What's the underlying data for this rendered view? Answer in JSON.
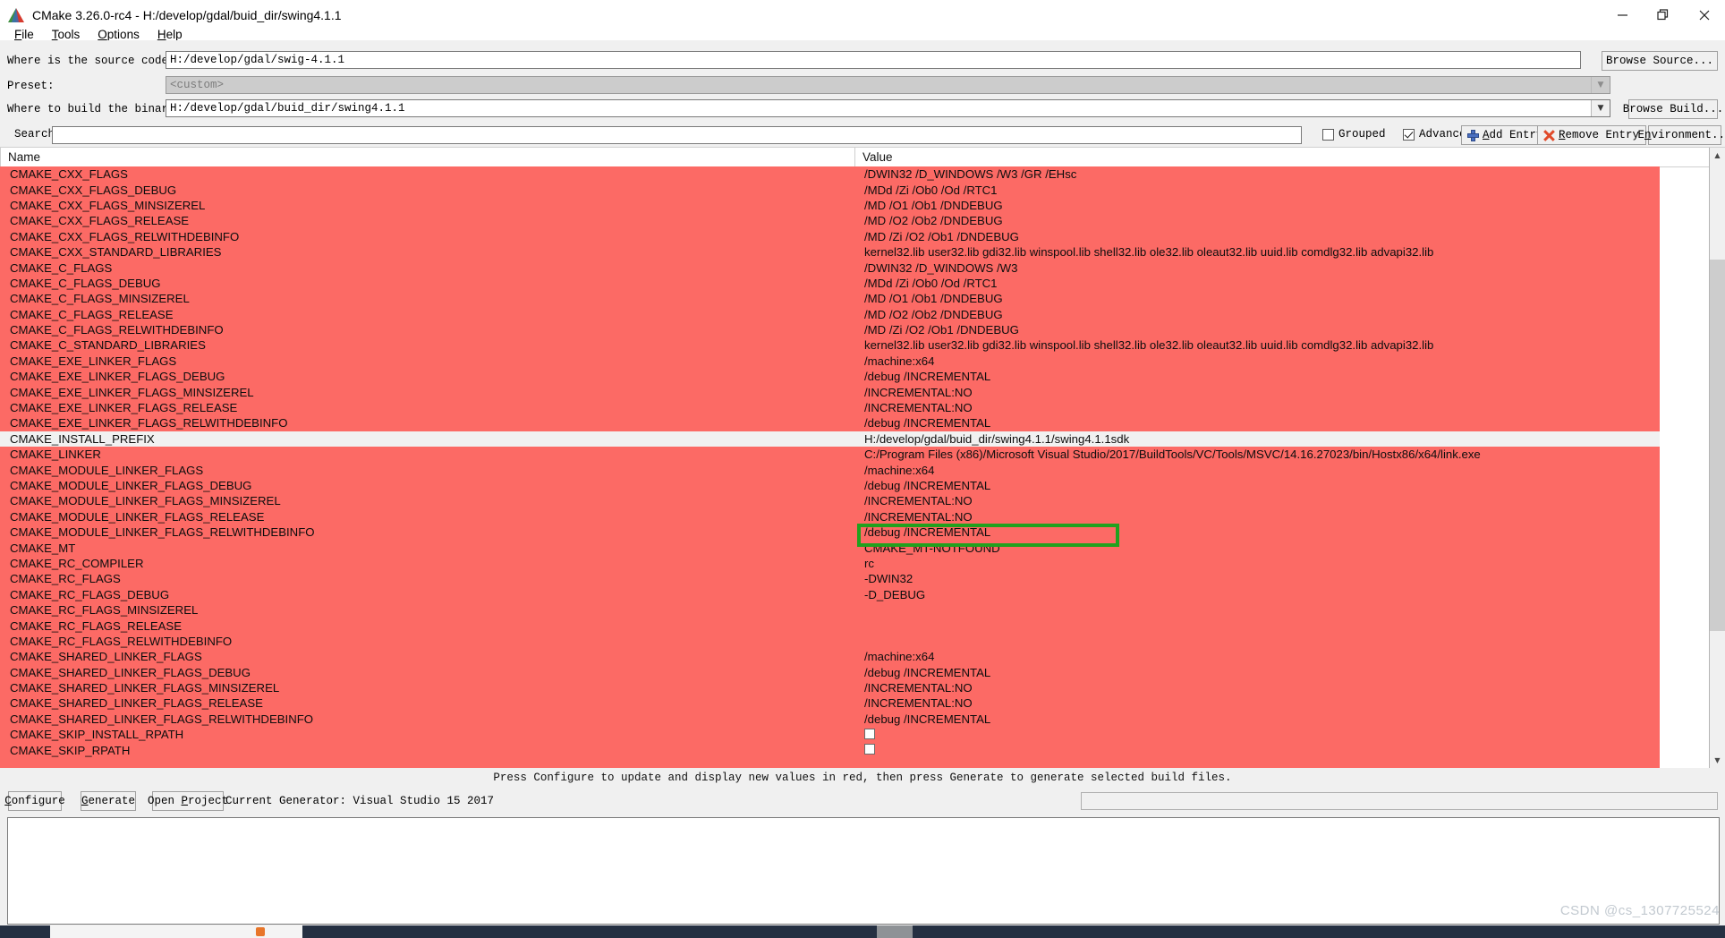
{
  "window": {
    "title": "CMake 3.26.0-rc4 - H:/develop/gdal/buid_dir/swing4.1.1",
    "app_icon": "cmake-triangle-icon",
    "controls": {
      "minimize": "—",
      "maximize": "❐",
      "close": "✕"
    }
  },
  "menubar": {
    "items": [
      {
        "label": "File",
        "mnemonic": "F"
      },
      {
        "label": "Tools",
        "mnemonic": "T"
      },
      {
        "label": "Options",
        "mnemonic": "O"
      },
      {
        "label": "Help",
        "mnemonic": "H"
      }
    ]
  },
  "form": {
    "source_label": "Where is the source code:",
    "source_value": "H:/develop/gdal/swig-4.1.1",
    "browse_source_label": "Browse Source...",
    "preset_label": "Preset:",
    "preset_value": "<custom>",
    "build_label": "Where to build the binaries:",
    "build_value": "H:/develop/gdal/buid_dir/swing4.1.1",
    "browse_build_label": "Browse Build..."
  },
  "search": {
    "label": "Search:",
    "value": "",
    "grouped_label": "Grouped",
    "grouped_checked": false,
    "advanced_label": "Advanced",
    "advanced_checked": true,
    "add_entry_label": "Add Entry",
    "remove_entry_label": "Remove Entry",
    "environment_label": "Environment..."
  },
  "table": {
    "columns": [
      "Name",
      "Value"
    ],
    "selected_index": 16,
    "rows": [
      {
        "name": "CMAKE_CXX_FLAGS",
        "value": "/DWIN32 /D_WINDOWS /W3 /GR /EHsc"
      },
      {
        "name": "CMAKE_CXX_FLAGS_DEBUG",
        "value": "/MDd /Zi /Ob0 /Od /RTC1"
      },
      {
        "name": "CMAKE_CXX_FLAGS_MINSIZEREL",
        "value": "/MD /O1 /Ob1 /DNDEBUG"
      },
      {
        "name": "CMAKE_CXX_FLAGS_RELEASE",
        "value": "/MD /O2 /Ob2 /DNDEBUG"
      },
      {
        "name": "CMAKE_CXX_FLAGS_RELWITHDEBINFO",
        "value": "/MD /Zi /O2 /Ob1 /DNDEBUG"
      },
      {
        "name": "CMAKE_CXX_STANDARD_LIBRARIES",
        "value": "kernel32.lib user32.lib gdi32.lib winspool.lib shell32.lib ole32.lib oleaut32.lib uuid.lib comdlg32.lib advapi32.lib"
      },
      {
        "name": "CMAKE_C_FLAGS",
        "value": "/DWIN32 /D_WINDOWS /W3"
      },
      {
        "name": "CMAKE_C_FLAGS_DEBUG",
        "value": "/MDd /Zi /Ob0 /Od /RTC1"
      },
      {
        "name": "CMAKE_C_FLAGS_MINSIZEREL",
        "value": "/MD /O1 /Ob1 /DNDEBUG"
      },
      {
        "name": "CMAKE_C_FLAGS_RELEASE",
        "value": "/MD /O2 /Ob2 /DNDEBUG"
      },
      {
        "name": "CMAKE_C_FLAGS_RELWITHDEBINFO",
        "value": "/MD /Zi /O2 /Ob1 /DNDEBUG"
      },
      {
        "name": "CMAKE_C_STANDARD_LIBRARIES",
        "value": "kernel32.lib user32.lib gdi32.lib winspool.lib shell32.lib ole32.lib oleaut32.lib uuid.lib comdlg32.lib advapi32.lib"
      },
      {
        "name": "CMAKE_EXE_LINKER_FLAGS",
        "value": "/machine:x64"
      },
      {
        "name": "CMAKE_EXE_LINKER_FLAGS_DEBUG",
        "value": "/debug /INCREMENTAL"
      },
      {
        "name": "CMAKE_EXE_LINKER_FLAGS_MINSIZEREL",
        "value": "/INCREMENTAL:NO"
      },
      {
        "name": "CMAKE_EXE_LINKER_FLAGS_RELEASE",
        "value": "/INCREMENTAL:NO"
      },
      {
        "name": "CMAKE_EXE_LINKER_FLAGS_RELWITHDEBINFO",
        "value": "/debug /INCREMENTAL"
      },
      {
        "name": "CMAKE_INSTALL_PREFIX",
        "value": "H:/develop/gdal/buid_dir/swing4.1.1/swing4.1.1sdk",
        "selected": true
      },
      {
        "name": "CMAKE_LINKER",
        "value": "C:/Program Files (x86)/Microsoft Visual Studio/2017/BuildTools/VC/Tools/MSVC/14.16.27023/bin/Hostx86/x64/link.exe"
      },
      {
        "name": "CMAKE_MODULE_LINKER_FLAGS",
        "value": "/machine:x64"
      },
      {
        "name": "CMAKE_MODULE_LINKER_FLAGS_DEBUG",
        "value": "/debug /INCREMENTAL"
      },
      {
        "name": "CMAKE_MODULE_LINKER_FLAGS_MINSIZEREL",
        "value": "/INCREMENTAL:NO"
      },
      {
        "name": "CMAKE_MODULE_LINKER_FLAGS_RELEASE",
        "value": "/INCREMENTAL:NO"
      },
      {
        "name": "CMAKE_MODULE_LINKER_FLAGS_RELWITHDEBINFO",
        "value": "/debug /INCREMENTAL"
      },
      {
        "name": "CMAKE_MT",
        "value": "CMAKE_MT-NOTFOUND"
      },
      {
        "name": "CMAKE_RC_COMPILER",
        "value": "rc"
      },
      {
        "name": "CMAKE_RC_FLAGS",
        "value": "-DWIN32"
      },
      {
        "name": "CMAKE_RC_FLAGS_DEBUG",
        "value": "-D_DEBUG"
      },
      {
        "name": "CMAKE_RC_FLAGS_MINSIZEREL",
        "value": ""
      },
      {
        "name": "CMAKE_RC_FLAGS_RELEASE",
        "value": ""
      },
      {
        "name": "CMAKE_RC_FLAGS_RELWITHDEBINFO",
        "value": ""
      },
      {
        "name": "CMAKE_SHARED_LINKER_FLAGS",
        "value": "/machine:x64"
      },
      {
        "name": "CMAKE_SHARED_LINKER_FLAGS_DEBUG",
        "value": "/debug /INCREMENTAL"
      },
      {
        "name": "CMAKE_SHARED_LINKER_FLAGS_MINSIZEREL",
        "value": "/INCREMENTAL:NO"
      },
      {
        "name": "CMAKE_SHARED_LINKER_FLAGS_RELEASE",
        "value": "/INCREMENTAL:NO"
      },
      {
        "name": "CMAKE_SHARED_LINKER_FLAGS_RELWITHDEBINFO",
        "value": "/debug /INCREMENTAL"
      },
      {
        "name": "CMAKE_SKIP_INSTALL_RPATH",
        "value": "",
        "checkbox": true
      },
      {
        "name": "CMAKE_SKIP_RPATH",
        "value": "",
        "checkbox": true
      },
      {
        "name": "",
        "value": ""
      }
    ]
  },
  "status": {
    "message": "Press Configure to update and display new values in red, then press Generate to generate selected build files."
  },
  "bottom": {
    "configure_label": "Configure",
    "generate_label": "Generate",
    "open_project_label": "Open Project",
    "generator_text": "Current Generator: Visual Studio 15 2017"
  },
  "watermark": {
    "text": "CSDN @cs_1307725524"
  },
  "colors": {
    "modified_row": "#fc6a65",
    "selected_row": "#f1f1f1",
    "annotation_box": "#21a11e",
    "window_bg": "#f0f0f0"
  }
}
